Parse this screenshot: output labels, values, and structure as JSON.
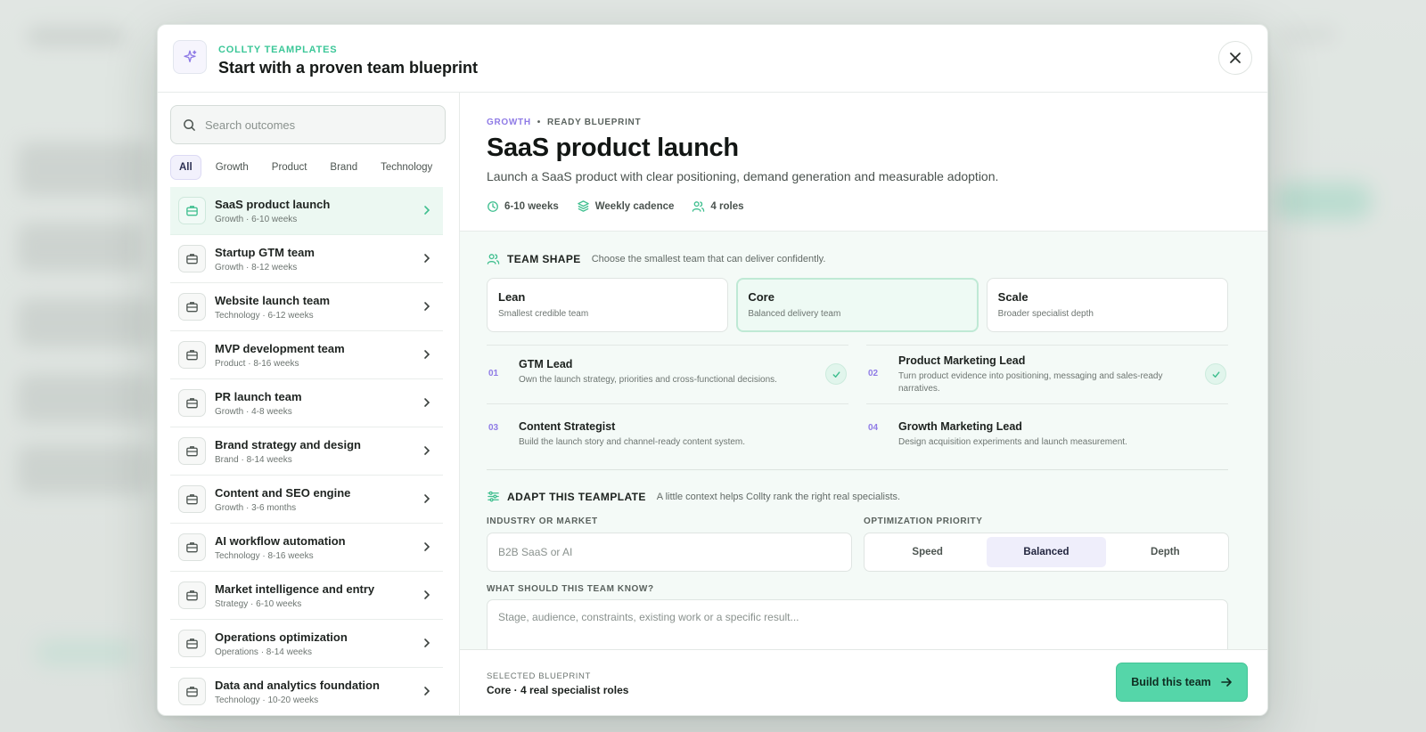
{
  "header": {
    "eyebrow": "COLLTY TEAMPLATES",
    "title": "Start with a proven team blueprint"
  },
  "sidebar": {
    "search_placeholder": "Search outcomes",
    "filters": [
      "All",
      "Growth",
      "Product",
      "Brand",
      "Technology"
    ],
    "active_filter": "All",
    "items": [
      {
        "title": "SaaS product launch",
        "sub": "Growth · 6-10 weeks"
      },
      {
        "title": "Startup GTM team",
        "sub": "Growth · 8-12 weeks"
      },
      {
        "title": "Website launch team",
        "sub": "Technology · 6-12 weeks"
      },
      {
        "title": "MVP development team",
        "sub": "Product · 8-16 weeks"
      },
      {
        "title": "PR launch team",
        "sub": "Growth · 4-8 weeks"
      },
      {
        "title": "Brand strategy and design",
        "sub": "Brand · 8-14 weeks"
      },
      {
        "title": "Content and SEO engine",
        "sub": "Growth · 3-6 months"
      },
      {
        "title": "AI workflow automation",
        "sub": "Technology · 8-16 weeks"
      },
      {
        "title": "Market intelligence and entry",
        "sub": "Strategy · 6-10 weeks"
      },
      {
        "title": "Operations optimization",
        "sub": "Operations · 8-14 weeks"
      },
      {
        "title": "Data and analytics foundation",
        "sub": "Technology · 10-20 weeks"
      }
    ]
  },
  "detail": {
    "category": "GROWTH",
    "status": "READY BLUEPRINT",
    "title": "SaaS product launch",
    "description": "Launch a SaaS product with clear positioning, demand generation and measurable adoption.",
    "meta": {
      "duration": "6-10 weeks",
      "cadence": "Weekly cadence",
      "roles": "4 roles"
    }
  },
  "team_shape": {
    "label": "TEAM SHAPE",
    "hint": "Choose the smallest team that can deliver confidently.",
    "options": [
      {
        "name": "Lean",
        "desc": "Smallest credible team"
      },
      {
        "name": "Core",
        "desc": "Balanced delivery team"
      },
      {
        "name": "Scale",
        "desc": "Broader specialist depth"
      }
    ],
    "selected": "Core"
  },
  "roles": [
    {
      "num": "01",
      "title": "GTM Lead",
      "desc": "Own the launch strategy, priorities and cross-functional decisions."
    },
    {
      "num": "02",
      "title": "Product Marketing Lead",
      "desc": "Turn product evidence into positioning, messaging and sales-ready narratives."
    },
    {
      "num": "03",
      "title": "Content Strategist",
      "desc": "Build the launch story and channel-ready content system."
    },
    {
      "num": "04",
      "title": "Growth Marketing Lead",
      "desc": "Design acquisition experiments and launch measurement."
    }
  ],
  "adapt": {
    "label": "ADAPT THIS TEAMPLATE",
    "hint": "A little context helps Collty rank the right real specialists.",
    "industry_label": "INDUSTRY OR MARKET",
    "industry_placeholder": "B2B SaaS or AI",
    "priority_label": "OPTIMIZATION PRIORITY",
    "priority_options": [
      "Speed",
      "Balanced",
      "Depth"
    ],
    "priority_selected": "Balanced",
    "know_label": "WHAT SHOULD THIS TEAM KNOW?",
    "know_placeholder": "Stage, audience, constraints, existing work or a specific result..."
  },
  "footer": {
    "label": "SELECTED BLUEPRINT",
    "value": "Core · 4 real specialist roles",
    "button": "Build this team"
  },
  "colors": {
    "accent_green": "#55d6a9",
    "accent_purple": "#8f7be6",
    "eyebrow_green": "#3cc798"
  }
}
